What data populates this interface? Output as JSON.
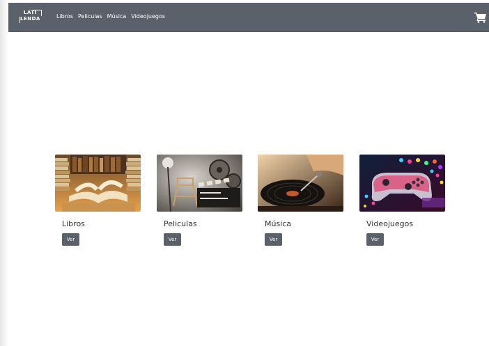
{
  "brand": {
    "line1": "LATI",
    "line2": "LENDA"
  },
  "nav": {
    "items": [
      {
        "label": "Libros"
      },
      {
        "label": "Peliculas"
      },
      {
        "label": "Música"
      },
      {
        "label": "Videojuegos"
      }
    ]
  },
  "cards": [
    {
      "title": "Libros",
      "button": "Ver"
    },
    {
      "title": "Peliculas",
      "button": "Ver"
    },
    {
      "title": "Música",
      "button": "Ver"
    },
    {
      "title": "Videojuegos",
      "button": "Ver"
    }
  ],
  "colors": {
    "navbar": "#5b616a",
    "button": "#5b616a",
    "text": "#333333"
  }
}
